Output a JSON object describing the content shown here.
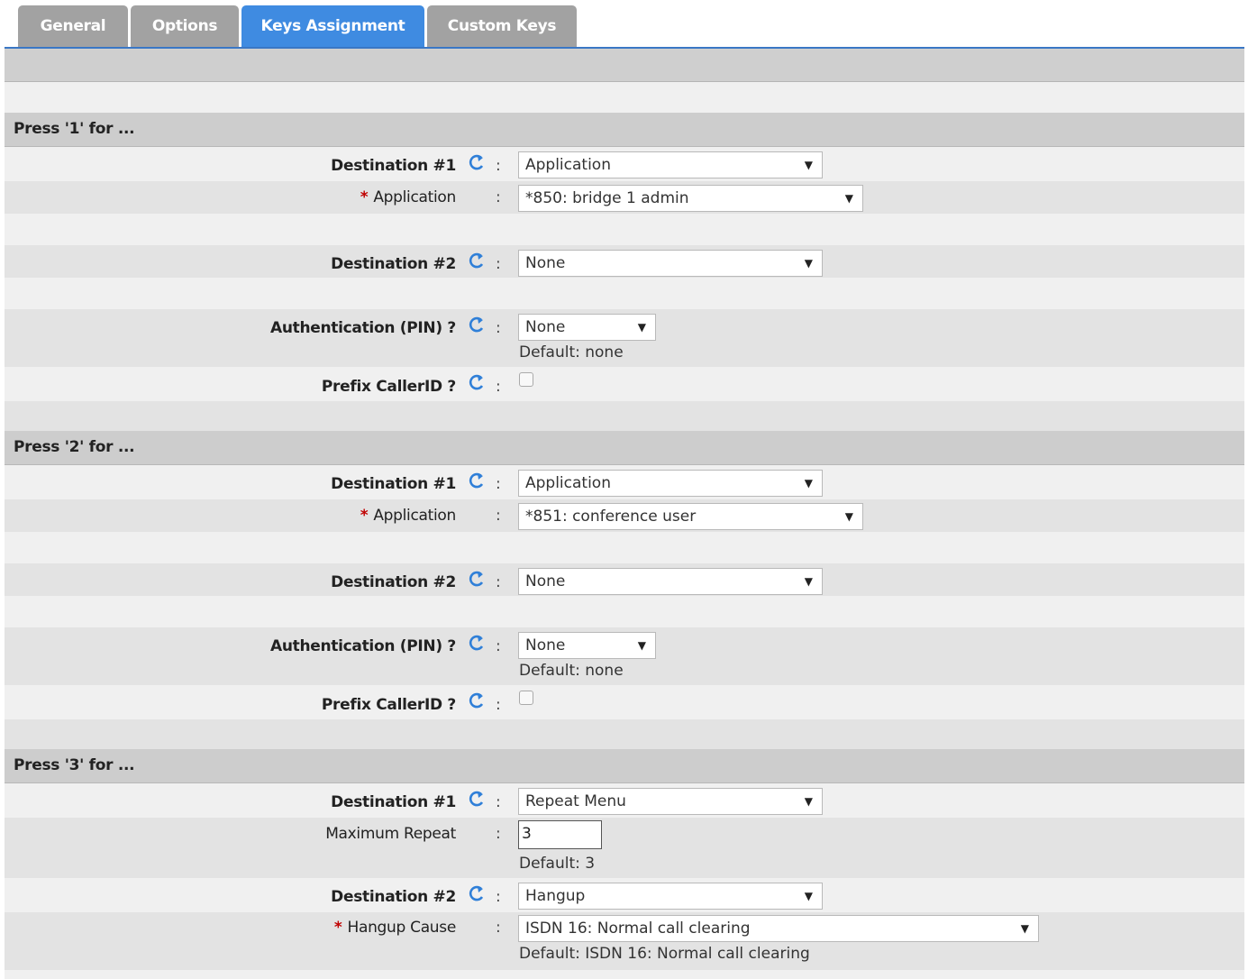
{
  "tabs": [
    {
      "label": "General",
      "active": false
    },
    {
      "label": "Options",
      "active": false
    },
    {
      "label": "Keys Assignment",
      "active": true
    },
    {
      "label": "Custom Keys",
      "active": false
    }
  ],
  "colors": {
    "tab_active": "#3f8be1",
    "tab_inactive": "#a2a2a2",
    "required_star": "#c00000",
    "refresh_icon": "#2f7fd8"
  },
  "common": {
    "colon": ":",
    "star": "*",
    "dest1_label": "Destination #1",
    "dest2_label": "Destination #2",
    "auth_label": "Authentication (PIN) ?",
    "prefix_label": "Prefix CallerID ?",
    "dropdown_arrow": "▼",
    "icons": {
      "refresh": "refresh-icon"
    }
  },
  "sections": [
    {
      "title": "Press '1' for ...",
      "dest1_value": "Application",
      "app_label": "Application",
      "app_value": "*850: bridge 1 admin",
      "dest2_value": "None",
      "auth_value": "None",
      "auth_default": "Default: none",
      "prefix_checked": false
    },
    {
      "title": "Press '2' for ...",
      "dest1_value": "Application",
      "app_label": "Application",
      "app_value": "*851: conference user",
      "dest2_value": "None",
      "auth_value": "None",
      "auth_default": "Default: none",
      "prefix_checked": false
    },
    {
      "title": "Press '3' for ...",
      "dest1_value": "Repeat Menu",
      "max_repeat_label": "Maximum Repeat",
      "max_repeat_value": "3",
      "max_repeat_default": "Default: 3",
      "dest2_value": "Hangup",
      "hangup_label": "Hangup Cause",
      "hangup_value": "ISDN 16: Normal call clearing",
      "hangup_default": "Default: ISDN 16: Normal call clearing"
    }
  ]
}
